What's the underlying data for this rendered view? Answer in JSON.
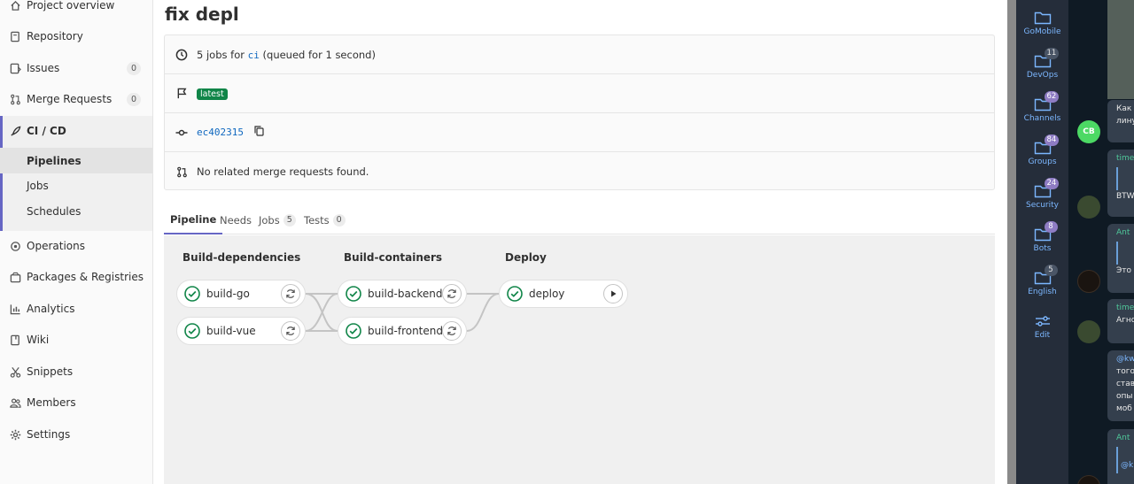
{
  "sidebar": {
    "items": [
      {
        "label": "Project overview"
      },
      {
        "label": "Repository"
      },
      {
        "label": "Issues",
        "count": "0"
      },
      {
        "label": "Merge Requests",
        "count": "0"
      },
      {
        "label": "CI / CD"
      },
      {
        "label": "Operations"
      },
      {
        "label": "Packages & Registries"
      },
      {
        "label": "Analytics"
      },
      {
        "label": "Wiki"
      },
      {
        "label": "Snippets"
      },
      {
        "label": "Members"
      },
      {
        "label": "Settings"
      }
    ],
    "cicd_sub": [
      {
        "label": "Pipelines"
      },
      {
        "label": "Jobs"
      },
      {
        "label": "Schedules"
      }
    ]
  },
  "page": {
    "title": "fix depl"
  },
  "info": {
    "jobs_prefix": "5 jobs for",
    "branch": "ci",
    "queued": "(queued for 1 second)",
    "latest_badge": "latest",
    "commit": "ec402315",
    "merge_requests": "No related merge requests found."
  },
  "tabs": [
    {
      "label": "Pipeline"
    },
    {
      "label": "Needs"
    },
    {
      "label": "Jobs",
      "count": "5"
    },
    {
      "label": "Tests",
      "count": "0"
    }
  ],
  "pipeline": {
    "stages": [
      {
        "name": "Build-dependencies",
        "jobs": [
          "build-go",
          "build-vue"
        ]
      },
      {
        "name": "Build-containers",
        "jobs": [
          "build-backend",
          "build-frontend"
        ]
      },
      {
        "name": "Deploy",
        "jobs": [
          "deploy"
        ]
      }
    ],
    "status_color": "#108548"
  },
  "telegram": {
    "folders": [
      {
        "label": "GoMobile",
        "count": ""
      },
      {
        "label": "DevOps",
        "count": "11"
      },
      {
        "label": "Channels",
        "count": "62"
      },
      {
        "label": "Groups",
        "count": "84"
      },
      {
        "label": "Security",
        "count": "24"
      },
      {
        "label": "Bots",
        "count": "8"
      },
      {
        "label": "English",
        "count": "5"
      },
      {
        "label": "Edit",
        "count": ""
      }
    ],
    "avatar_initials": "CB",
    "messages": [
      {
        "line1": "Как",
        "line2": "лину"
      },
      {
        "sender": "time",
        "line1": "BTW"
      },
      {
        "sender": "Ant",
        "line1": "Это"
      },
      {
        "sender": "time",
        "line1": "Агно"
      },
      {
        "mention": "@kw",
        "lines": [
          "того",
          "став",
          "опы",
          "моб"
        ]
      },
      {
        "sender": "Ant",
        "mention": "@k"
      }
    ]
  }
}
